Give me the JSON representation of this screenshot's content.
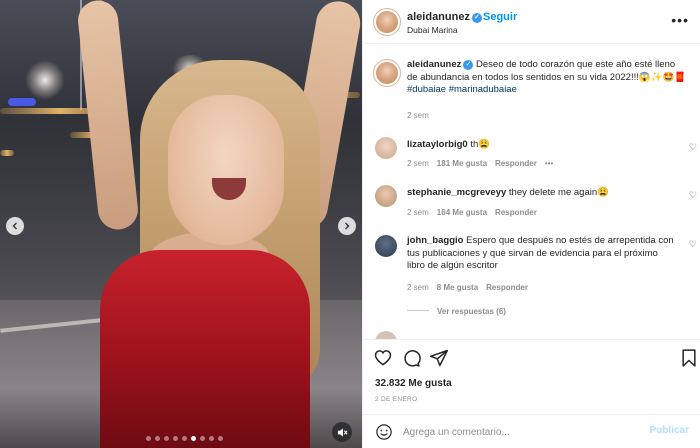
{
  "post": {
    "username": "aleidanunez",
    "follow_label": "Seguir",
    "location": "Dubai Marina",
    "caption_username": "aleidanunez",
    "caption_text": "Deseo de todo corazón que este año esté lleno de abundancia en todos los sentidos en su vida 2022!!!😱✨🤩🧧",
    "caption_tags": "#dubaiae #marinadubaiae",
    "caption_time": "2 sem",
    "likes": "32.832 Me gusta",
    "date": "2 DE ENERO"
  },
  "comments": [
    {
      "username": "lizataylorbig0",
      "text": "th😩",
      "time": "2 sem",
      "likes": "181 Me gusta",
      "reply": "Responder",
      "more": "•••"
    },
    {
      "username": "stephanie_mcgreveyy",
      "text": "they delete me again😩",
      "time": "2 sem",
      "likes": "164 Me gusta",
      "reply": "Responder"
    },
    {
      "username": "john_baggio",
      "text": "Espero que después no estés de arrepentida con tus publicaciones y que sirvan de evidencia para el próximo libro de algún escritor",
      "time": "2 sem",
      "likes": "8 Me gusta",
      "reply": "Responder",
      "see_replies": "Ver respuestas (6)"
    }
  ],
  "composer": {
    "placeholder": "Agrega un comentario...",
    "publish_label": "Publicar"
  },
  "icons": {
    "like": "heart-icon",
    "comment": "comment-icon",
    "share": "share-icon",
    "save": "bookmark-icon",
    "emoji": "smiley-icon",
    "mute": "speaker-muted-icon",
    "verified": "verified-badge-icon"
  },
  "carousel": {
    "slide_count": 9,
    "active_slide": 6
  },
  "colors": {
    "link": "#0095f6",
    "muted": "#8e8e8e",
    "verified": "#3897f0"
  }
}
